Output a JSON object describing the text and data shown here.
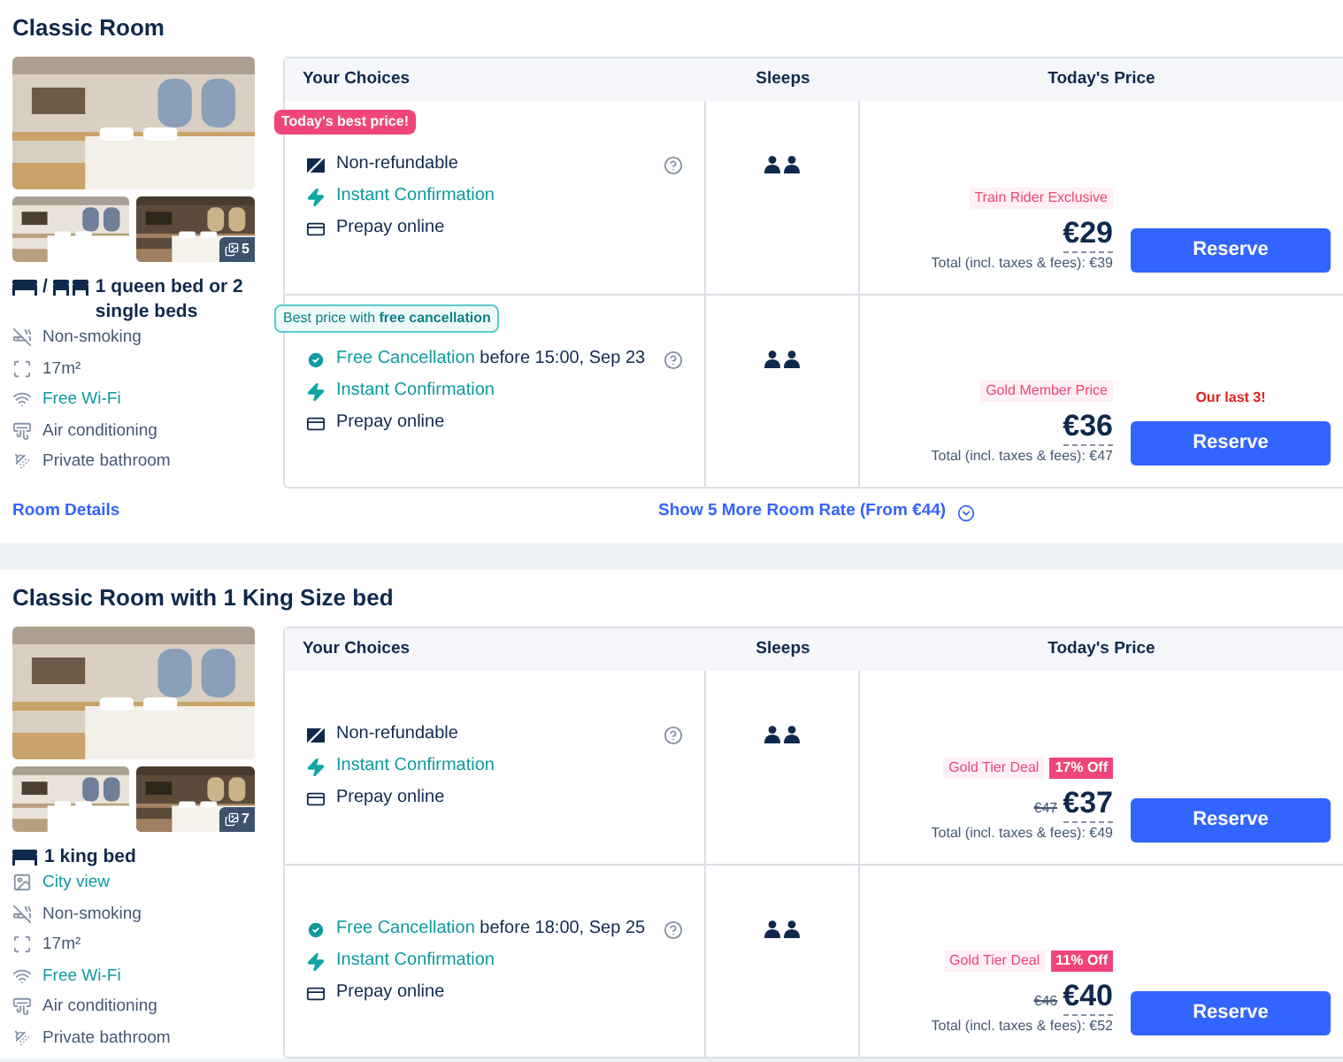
{
  "rooms": [
    {
      "title": "Classic Room",
      "photo_count": "5",
      "bed": {
        "icons": [
          {
            "kind": "double"
          },
          {
            "kind": "twin"
          }
        ],
        "separator": "/",
        "text": "1 queen bed or 2 single beds"
      },
      "amenities": [
        {
          "kind": "smoke",
          "text": "Non-smoking",
          "highlight": false
        },
        {
          "kind": "size",
          "text": "17m²",
          "highlight": false
        },
        {
          "kind": "wifi",
          "text": "Free Wi-Fi",
          "highlight": true
        },
        {
          "kind": "ac",
          "text": "Air conditioning",
          "highlight": false
        },
        {
          "kind": "bath",
          "text": "Private bathroom",
          "highlight": false
        }
      ],
      "details_link": "Room Details",
      "more_rates": "Show 5 More Room Rate (From €44)",
      "columns": [
        "Your Choices",
        "Sleeps",
        "Today's Price"
      ],
      "rates": [
        {
          "ribbon": {
            "kind": "best",
            "text": "Today's best price!"
          },
          "features": [
            {
              "kind": "nonrefund",
              "text": "Non-refundable",
              "accent": false
            },
            {
              "kind": "instant",
              "text": "Instant Confirmation",
              "accent": true
            },
            {
              "kind": "prepay",
              "text": "Prepay online",
              "accent": false
            }
          ],
          "deal": "Train Rider Exclusive",
          "price": "€29",
          "total": "Total (incl. taxes & fees): €39",
          "button": "Reserve"
        },
        {
          "ribbon": {
            "kind": "cancel",
            "text": "Best price with **free cancellation**"
          },
          "features": [
            {
              "kind": "cancel",
              "text": "Free Cancellation",
              "detail": " before 15:00, Sep 23",
              "accent": true
            },
            {
              "kind": "instant",
              "text": "Instant Confirmation",
              "accent": true
            },
            {
              "kind": "prepay",
              "text": "Prepay online",
              "accent": false
            }
          ],
          "deal": "Gold Member Price",
          "price": "€36",
          "total": "Total (incl. taxes & fees): €47",
          "scarcity": "Our last 3!",
          "button": "Reserve"
        }
      ]
    },
    {
      "title": "Classic Room with 1 King Size bed",
      "photo_count": "7",
      "bed": {
        "icons": [
          {
            "kind": "double"
          }
        ],
        "text": "1 king bed"
      },
      "amenities": [
        {
          "kind": "view",
          "text": "City view",
          "highlight": true
        },
        {
          "kind": "smoke",
          "text": "Non-smoking",
          "highlight": false
        },
        {
          "kind": "size",
          "text": "17m²",
          "highlight": false
        },
        {
          "kind": "wifi",
          "text": "Free Wi-Fi",
          "highlight": true
        },
        {
          "kind": "ac",
          "text": "Air conditioning",
          "highlight": false
        },
        {
          "kind": "bath",
          "text": "Private bathroom",
          "highlight": false
        }
      ],
      "columns": [
        "Your Choices",
        "Sleeps",
        "Today's Price"
      ],
      "rates": [
        {
          "features": [
            {
              "kind": "nonrefund",
              "text": "Non-refundable",
              "accent": false
            },
            {
              "kind": "instant",
              "text": "Instant Confirmation",
              "accent": true
            },
            {
              "kind": "prepay",
              "text": "Prepay online",
              "accent": false
            }
          ],
          "deal": "Gold Tier Deal",
          "discount": "17% Off",
          "old_price": "€47",
          "price": "€37",
          "total": "Total (incl. taxes & fees): €49",
          "button": "Reserve"
        },
        {
          "features": [
            {
              "kind": "cancel",
              "text": "Free Cancellation",
              "detail": " before 18:00, Sep 25",
              "accent": true
            },
            {
              "kind": "instant",
              "text": "Instant Confirmation",
              "accent": true
            },
            {
              "kind": "prepay",
              "text": "Prepay online",
              "accent": false
            }
          ],
          "deal": "Gold Tier Deal",
          "discount": "11% Off",
          "old_price": "€46",
          "price": "€40",
          "total": "Total (incl. taxes & fees): €52",
          "button": "Reserve"
        }
      ]
    }
  ]
}
